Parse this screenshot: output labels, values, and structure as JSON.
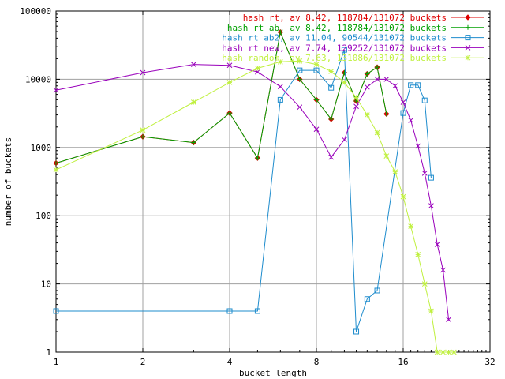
{
  "chart_data": {
    "type": "line",
    "xlabel": "bucket length",
    "ylabel": "number of buckets",
    "x_scale": "log2",
    "y_scale": "log10",
    "xlim": [
      1,
      32
    ],
    "ylim": [
      1,
      100000
    ],
    "x_ticks": [
      {
        "value": 1,
        "label": "1"
      },
      {
        "value": 2,
        "label": "2"
      },
      {
        "value": 4,
        "label": "4"
      },
      {
        "value": 8,
        "label": "8"
      },
      {
        "value": 16,
        "label": "16"
      },
      {
        "value": 32,
        "label": "32"
      }
    ],
    "y_ticks": [
      {
        "value": 1,
        "label": "1"
      },
      {
        "value": 10,
        "label": "10"
      },
      {
        "value": 100,
        "label": "100"
      },
      {
        "value": 1000,
        "label": "1000"
      },
      {
        "value": 10000,
        "label": "10000"
      },
      {
        "value": 100000,
        "label": "100000"
      }
    ],
    "grid": true,
    "legend_position": "top-right",
    "series": [
      {
        "name": "hash rt, av 8.42, 118784/131072 buckets",
        "color": "#dd0000",
        "marker": "diamond",
        "points": [
          [
            1,
            590
          ],
          [
            2,
            1440
          ],
          [
            3,
            1180
          ],
          [
            4,
            3200
          ],
          [
            5,
            700
          ],
          [
            6,
            49000
          ],
          [
            7,
            10000
          ],
          [
            8,
            5000
          ],
          [
            9,
            2600
          ],
          [
            10,
            12500
          ],
          [
            11,
            4800
          ],
          [
            12,
            12000
          ],
          [
            13,
            15000
          ],
          [
            14,
            3100
          ]
        ]
      },
      {
        "name": "hash rt ab, av 8.42, 118784/131072 buckets",
        "color": "#00a000",
        "marker": "plus",
        "points": [
          [
            1,
            590
          ],
          [
            2,
            1440
          ],
          [
            3,
            1180
          ],
          [
            4,
            3200
          ],
          [
            5,
            700
          ],
          [
            6,
            49000
          ],
          [
            7,
            10000
          ],
          [
            8,
            5000
          ],
          [
            9,
            2600
          ],
          [
            10,
            12500
          ],
          [
            11,
            4800
          ],
          [
            12,
            12000
          ],
          [
            13,
            15000
          ],
          [
            14,
            3100
          ]
        ]
      },
      {
        "name": "hash rt ab2, av 11.04, 90544/131072 buckets",
        "color": "#1e8ccd",
        "marker": "square",
        "points": [
          [
            1,
            4
          ],
          [
            4,
            4
          ],
          [
            5,
            4
          ],
          [
            6,
            5000
          ],
          [
            7,
            13500
          ],
          [
            8,
            13500
          ],
          [
            9,
            7500
          ],
          [
            10,
            27000
          ],
          [
            11,
            2
          ],
          [
            12,
            6
          ],
          [
            13,
            8
          ],
          [
            16,
            3200
          ],
          [
            17,
            8200
          ],
          [
            18,
            8200
          ],
          [
            19,
            4900
          ],
          [
            20,
            360
          ]
        ]
      },
      {
        "name": "hash rt new, av 7.74, 129252/131072 buckets",
        "color": "#9900bb",
        "marker": "x",
        "points": [
          [
            1,
            6900
          ],
          [
            2,
            12500
          ],
          [
            3,
            16500
          ],
          [
            4,
            16000
          ],
          [
            5,
            12800
          ],
          [
            6,
            7800
          ],
          [
            7,
            3900
          ],
          [
            8,
            1850
          ],
          [
            9,
            720
          ],
          [
            10,
            1300
          ],
          [
            11,
            4000
          ],
          [
            12,
            7700
          ],
          [
            13,
            10000
          ],
          [
            14,
            10000
          ],
          [
            15,
            8000
          ],
          [
            16,
            4600
          ],
          [
            17,
            2500
          ],
          [
            18,
            1050
          ],
          [
            19,
            420
          ],
          [
            20,
            140
          ],
          [
            21,
            38
          ],
          [
            22,
            16
          ],
          [
            23,
            3
          ]
        ]
      },
      {
        "name": "hash random, av 7.63, 131086/131072 buckets",
        "color": "#c0f040",
        "marker": "star",
        "points": [
          [
            1,
            470
          ],
          [
            2,
            1800
          ],
          [
            3,
            4600
          ],
          [
            4,
            9000
          ],
          [
            5,
            14500
          ],
          [
            6,
            18000
          ],
          [
            7,
            18500
          ],
          [
            8,
            16500
          ],
          [
            9,
            13000
          ],
          [
            10,
            9000
          ],
          [
            11,
            5400
          ],
          [
            12,
            3000
          ],
          [
            13,
            1650
          ],
          [
            14,
            750
          ],
          [
            15,
            440
          ],
          [
            16,
            190
          ],
          [
            17,
            70
          ],
          [
            18,
            27
          ],
          [
            19,
            10
          ],
          [
            20,
            4
          ],
          [
            21,
            1
          ],
          [
            22,
            1
          ],
          [
            23,
            1
          ],
          [
            24,
            1
          ]
        ]
      }
    ]
  }
}
